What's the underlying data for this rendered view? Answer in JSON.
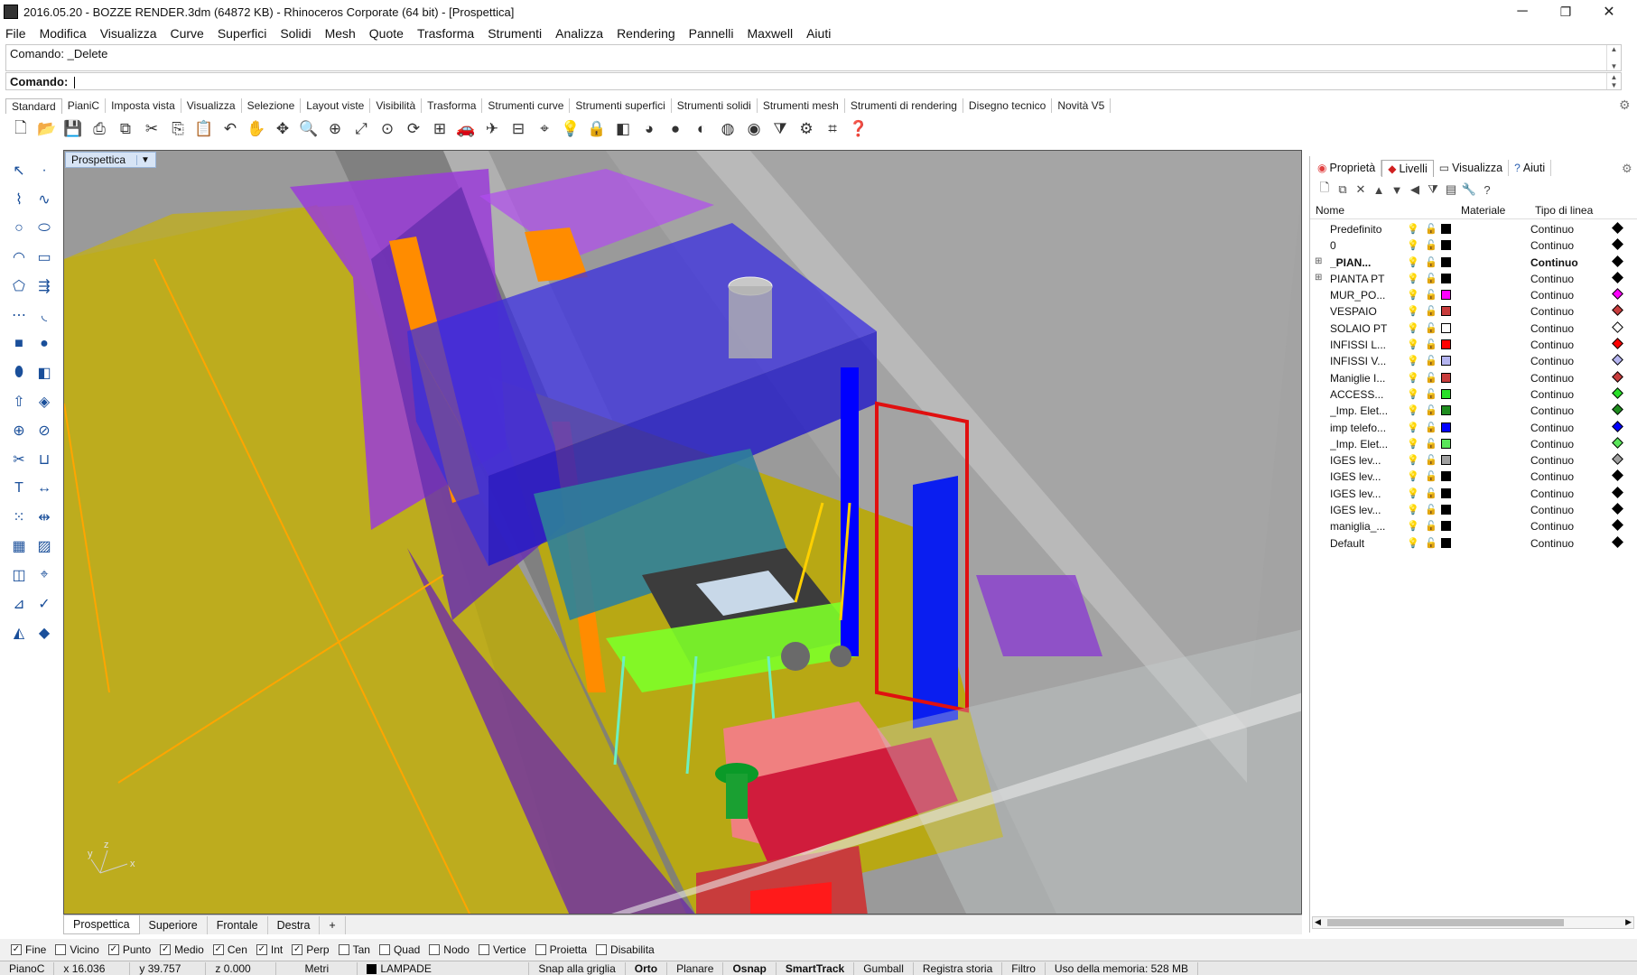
{
  "window": {
    "title": "2016.05.20 - BOZZE RENDER.3dm (64872 KB) - Rhinoceros Corporate (64 bit) - [Prospettica]",
    "minimize": "─",
    "maximize": "❐",
    "close": "✕"
  },
  "menu": [
    "File",
    "Modifica",
    "Visualizza",
    "Curve",
    "Superfici",
    "Solidi",
    "Mesh",
    "Quote",
    "Trasforma",
    "Strumenti",
    "Analizza",
    "Rendering",
    "Pannelli",
    "Maxwell",
    "Aiuti"
  ],
  "command": {
    "history": "Comando: _Delete",
    "prompt": "Comando:"
  },
  "toolbar_tabs": [
    "Standard",
    "PianiC",
    "Imposta vista",
    "Visualizza",
    "Selezione",
    "Layout viste",
    "Visibilità",
    "Trasforma",
    "Strumenti curve",
    "Strumenti superfici",
    "Strumenti solidi",
    "Strumenti mesh",
    "Strumenti di rendering",
    "Disegno tecnico",
    "Novità V5"
  ],
  "toolbar_icons": [
    "new-icon",
    "open-icon",
    "save-icon",
    "print-icon",
    "import-icon",
    "cut-icon",
    "copy-icon",
    "paste-icon",
    "undo-icon",
    "pan-icon",
    "move-view-icon",
    "zoom-icon",
    "zoom-window-icon",
    "zoom-extents-icon",
    "zoom-selected-icon",
    "rotate-view-icon",
    "four-views-icon",
    "car-icon",
    "plane-icon",
    "grid-icon",
    "snap-icon",
    "light-icon",
    "lock-icon",
    "layer-icon",
    "color-wheel-icon",
    "render-sphere-icon",
    "shaded-sphere-icon",
    "material-sphere-icon",
    "environment-icon",
    "filter-icon",
    "gear-icon",
    "options-icon",
    "help-icon"
  ],
  "viewport": {
    "name": "Prospettica",
    "tabs": [
      "Prospettica",
      "Superiore",
      "Frontale",
      "Destra"
    ],
    "add_tab": "+",
    "axis_x": "x",
    "axis_y": "y",
    "axis_z": "z"
  },
  "osnaps": [
    {
      "label": "Fine",
      "checked": true
    },
    {
      "label": "Vicino",
      "checked": false
    },
    {
      "label": "Punto",
      "checked": true
    },
    {
      "label": "Medio",
      "checked": true
    },
    {
      "label": "Cen",
      "checked": true
    },
    {
      "label": "Int",
      "checked": true
    },
    {
      "label": "Perp",
      "checked": true
    },
    {
      "label": "Tan",
      "checked": false
    },
    {
      "label": "Quad",
      "checked": false
    },
    {
      "label": "Nodo",
      "checked": false
    },
    {
      "label": "Vertice",
      "checked": false
    },
    {
      "label": "Proietta",
      "checked": false
    },
    {
      "label": "Disabilita",
      "checked": false
    }
  ],
  "status": {
    "cplane": "PianoC",
    "x": "x 16.036",
    "y": "y 39.757",
    "z": "z 0.000",
    "units": "Metri",
    "layer": "LAMPADE",
    "items": [
      "Snap alla griglia",
      "Orto",
      "Planare",
      "Osnap",
      "SmartTrack",
      "Gumball",
      "Registra storia",
      "Filtro",
      "Uso della memoria: 528 MB"
    ]
  },
  "panel": {
    "tabs": [
      "Proprietà",
      "Livelli",
      "Visualizza",
      "Aiuti"
    ],
    "active_tab": "Livelli",
    "columns": {
      "name": "Nome",
      "material": "Materiale",
      "linetype": "Tipo di linea"
    },
    "layers": [
      {
        "name": "Predefinito",
        "color": "#000000",
        "linetype": "Continuo",
        "expand": "",
        "bold": false
      },
      {
        "name": "0",
        "color": "#000000",
        "linetype": "Continuo",
        "expand": "",
        "bold": false
      },
      {
        "name": "_PIAN...",
        "color": "#000000",
        "linetype": "Continuo",
        "expand": "⊞",
        "bold": true
      },
      {
        "name": "PIANTA PT",
        "color": "#000000",
        "linetype": "Continuo",
        "expand": "⊞",
        "bold": false
      },
      {
        "name": "MUR_PO...",
        "color": "#ff00ff",
        "linetype": "Continuo",
        "expand": "",
        "bold": false
      },
      {
        "name": "VESPAIO",
        "color": "#c83c3c",
        "linetype": "Continuo",
        "expand": "",
        "bold": false
      },
      {
        "name": "SOLAIO PT",
        "color": "#ffffff",
        "linetype": "Continuo",
        "expand": "",
        "bold": false
      },
      {
        "name": "INFISSI L...",
        "color": "#ff0000",
        "linetype": "Continuo",
        "expand": "",
        "bold": false
      },
      {
        "name": "INFISSI V...",
        "color": "#b4b4f0",
        "linetype": "Continuo",
        "expand": "",
        "bold": false
      },
      {
        "name": "Maniglie I...",
        "color": "#c83c3c",
        "linetype": "Continuo",
        "expand": "",
        "bold": false
      },
      {
        "name": "ACCESS...",
        "color": "#28e028",
        "linetype": "Continuo",
        "expand": "",
        "bold": false
      },
      {
        "name": "_Imp. Elet...",
        "color": "#1e8c1e",
        "linetype": "Continuo",
        "expand": "",
        "bold": false
      },
      {
        "name": "imp telefo...",
        "color": "#0000ff",
        "linetype": "Continuo",
        "expand": "",
        "bold": false
      },
      {
        "name": "_Imp. Elet...",
        "color": "#5ae65a",
        "linetype": "Continuo",
        "expand": "",
        "bold": false
      },
      {
        "name": "IGES lev...",
        "color": "#a0a0a0",
        "linetype": "Continuo",
        "expand": "",
        "bold": false
      },
      {
        "name": "IGES lev...",
        "color": "#000000",
        "linetype": "Continuo",
        "expand": "",
        "bold": false
      },
      {
        "name": "IGES lev...",
        "color": "#000000",
        "linetype": "Continuo",
        "expand": "",
        "bold": false
      },
      {
        "name": "IGES lev...",
        "color": "#000000",
        "linetype": "Continuo",
        "expand": "",
        "bold": false
      },
      {
        "name": "maniglia_...",
        "color": "#000000",
        "linetype": "Continuo",
        "expand": "",
        "bold": false
      },
      {
        "name": "Default",
        "color": "#000000",
        "linetype": "Continuo",
        "expand": "",
        "bold": false
      }
    ]
  }
}
